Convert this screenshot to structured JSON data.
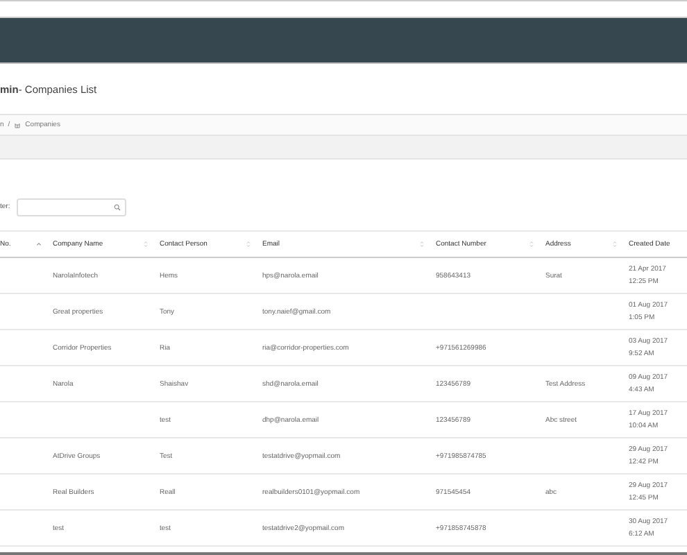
{
  "page_title": {
    "prefix": "min",
    "title": " - Companies List"
  },
  "breadcrumb": {
    "parent": "n",
    "separator": "/",
    "current": "Companies"
  },
  "filter": {
    "label": "ter:"
  },
  "table": {
    "columns": [
      {
        "label": "No.",
        "kind": "ascending"
      },
      {
        "label": "Company Name",
        "kind": "sortable"
      },
      {
        "label": "Contact Person",
        "kind": "sortable"
      },
      {
        "label": "Email",
        "kind": "sortable"
      },
      {
        "label": "Contact Number",
        "kind": "sortable"
      },
      {
        "label": "Address",
        "kind": "sortable"
      },
      {
        "label": "Created Date",
        "kind": "plain"
      }
    ],
    "rows": [
      {
        "company": "NarolaInfotech",
        "person": "Hems",
        "email": "hps@narola.email",
        "phone": "958643413",
        "address": "Surat",
        "date": "21 Apr 2017",
        "time": "12:25 PM"
      },
      {
        "company": "Great properties",
        "person": "Tony",
        "email": "tony.naief@gmail.com",
        "date": "01 Aug 2017",
        "time": "1:05 PM"
      },
      {
        "company": "Corridor Properties",
        "person": "Ria",
        "email": "ria@corridor-properties.com",
        "phone": "+971561269986",
        "date": "03 Aug 2017",
        "time": "9:52 AM"
      },
      {
        "company": "Narola",
        "person": "Shaishav",
        "email": "shd@narola.email",
        "phone": "123456789",
        "address": "Test Address",
        "date": "09 Aug 2017",
        "time": "4:43 AM"
      },
      {
        "person": "test",
        "email": "dhp@narola.email",
        "phone": "123456789",
        "address": "Abc street",
        "date": "17 Aug 2017",
        "time": "10:04 AM"
      },
      {
        "company": "AtDrive Groups",
        "person": "Test",
        "email": "testatdrive@yopmail.com",
        "phone": "+971985874785",
        "date": "29 Aug 2017",
        "time": "12:42 PM"
      },
      {
        "company": "Real Builders",
        "person": "Reall",
        "email": "realbuilders0101@yopmail.com",
        "phone": "971545454",
        "address": "abc",
        "date": "29 Aug 2017",
        "time": "12:45 PM"
      },
      {
        "company": "test",
        "person": "test",
        "email": "testatdrive2@yopmail.com",
        "phone": "+971858745878",
        "date": "30 Aug 2017",
        "time": "6:12 AM"
      }
    ]
  }
}
